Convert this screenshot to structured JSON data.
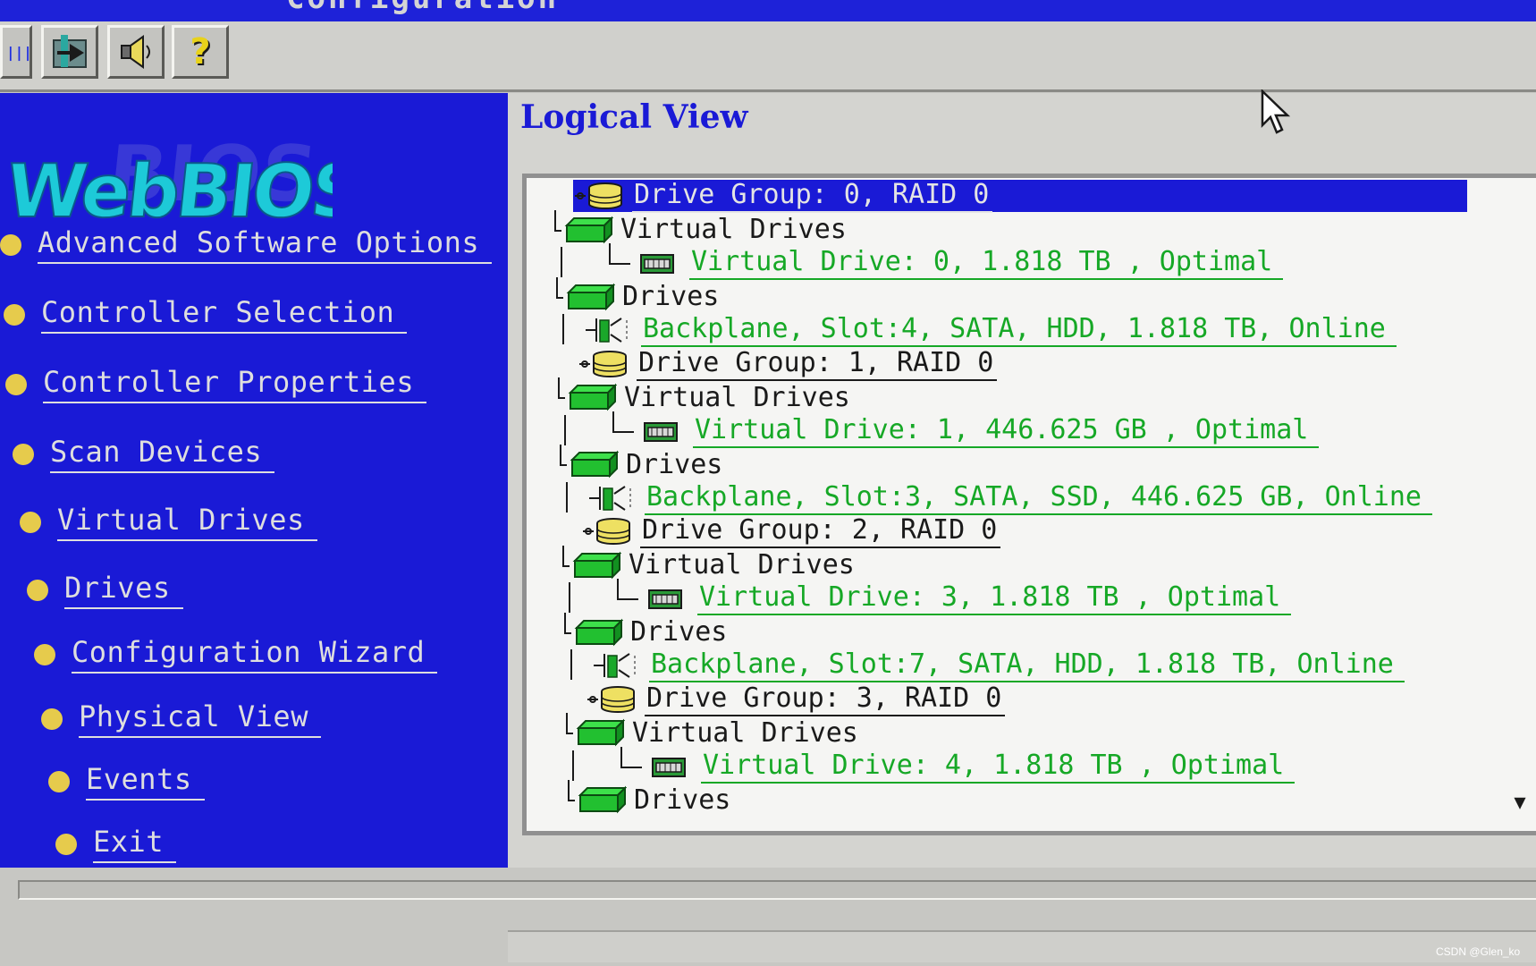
{
  "window": {
    "title": "Configuration"
  },
  "toolbar": {
    "buttons": [
      {
        "name": "home-icon"
      },
      {
        "name": "speaker-icon"
      },
      {
        "name": "help-icon",
        "glyph": "?"
      }
    ]
  },
  "sidebar": {
    "logo_text": "WebBIOS",
    "items": [
      {
        "label": "Advanced Software Options"
      },
      {
        "label": "Controller Selection"
      },
      {
        "label": "Controller Properties"
      },
      {
        "label": "Scan Devices"
      },
      {
        "label": "Virtual Drives"
      },
      {
        "label": "Drives"
      },
      {
        "label": "Configuration Wizard"
      },
      {
        "label": "Physical View"
      },
      {
        "label": "Events"
      },
      {
        "label": "Exit"
      }
    ]
  },
  "main": {
    "title": "Logical View",
    "tree": [
      {
        "type": "drive-group",
        "label": "Drive Group: 0, RAID 0",
        "selected": true
      },
      {
        "type": "group",
        "label": "Virtual Drives"
      },
      {
        "type": "virtual-drive",
        "label": "Virtual Drive: 0, 1.818 TB , Optimal"
      },
      {
        "type": "group",
        "label": "Drives"
      },
      {
        "type": "backplane",
        "label": "Backplane, Slot:4, SATA, HDD, 1.818 TB, Online"
      },
      {
        "type": "drive-group",
        "label": "Drive Group: 1, RAID 0"
      },
      {
        "type": "group",
        "label": "Virtual Drives"
      },
      {
        "type": "virtual-drive",
        "label": "Virtual Drive: 1, 446.625 GB , Optimal"
      },
      {
        "type": "group",
        "label": "Drives"
      },
      {
        "type": "backplane",
        "label": "Backplane, Slot:3, SATA, SSD, 446.625 GB, Online"
      },
      {
        "type": "drive-group",
        "label": "Drive Group: 2, RAID 0"
      },
      {
        "type": "group",
        "label": "Virtual Drives"
      },
      {
        "type": "virtual-drive",
        "label": "Virtual Drive: 3, 1.818 TB , Optimal"
      },
      {
        "type": "group",
        "label": "Drives"
      },
      {
        "type": "backplane",
        "label": "Backplane, Slot:7, SATA, HDD, 1.818 TB, Online"
      },
      {
        "type": "drive-group",
        "label": "Drive Group: 3, RAID 0"
      },
      {
        "type": "group",
        "label": "Virtual Drives"
      },
      {
        "type": "virtual-drive",
        "label": "Virtual Drive: 4, 1.818 TB , Optimal"
      },
      {
        "type": "group",
        "label": "Drives"
      }
    ],
    "scroll_arrow": "▼"
  },
  "watermark": "CSDN @Glen_ko",
  "colors": {
    "sidebar_bg": "#1a1ad6",
    "tree_green": "#16a826",
    "selection": "#1a1ad6",
    "bullet": "#e6cb4c"
  }
}
